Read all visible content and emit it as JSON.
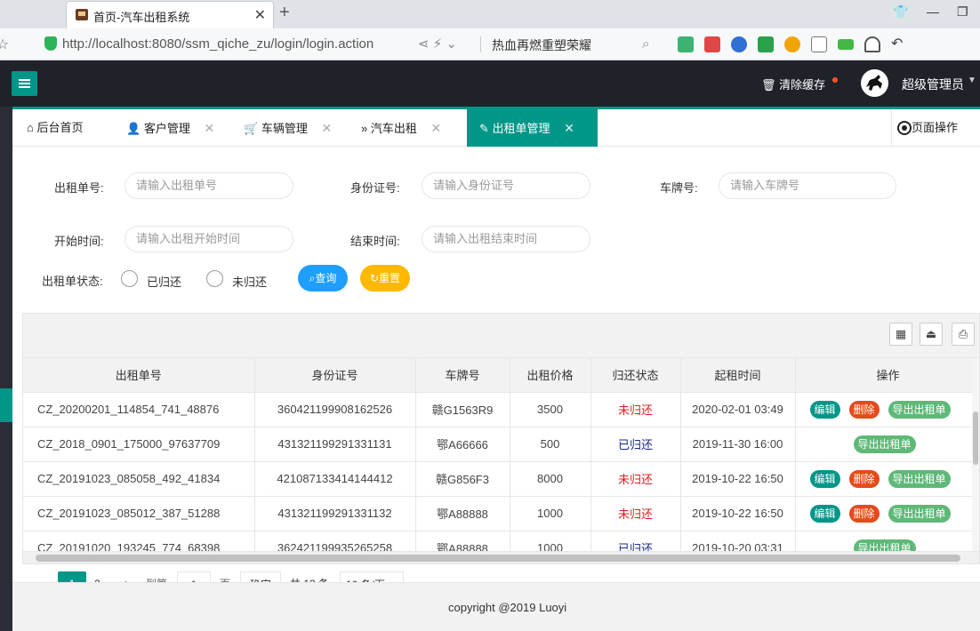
{
  "browser": {
    "tab_title": "首页-汽车出租系统",
    "url": "http://localhost:8080/ssm_qiche_zu/login/login.action",
    "search_hint": "热血再燃重塑荣耀"
  },
  "header": {
    "clear_cache": "清除缓存",
    "admin_name": "超级管理员"
  },
  "tabs": [
    {
      "label": "后台首页"
    },
    {
      "label": "客户管理"
    },
    {
      "label": "车辆管理"
    },
    {
      "label": "汽车出租"
    },
    {
      "label": "出租单管理"
    }
  ],
  "page_op": "页面操作",
  "filters": {
    "order_no_label": "出租单号:",
    "order_no_placeholder": "请输入出租单号",
    "id_label": "身份证号:",
    "id_placeholder": "请输入身份证号",
    "plate_label": "车牌号:",
    "plate_placeholder": "请输入车牌号",
    "start_label": "开始时间:",
    "start_placeholder": "请输入出租开始时间",
    "end_label": "结束时间:",
    "end_placeholder": "请输入出租结束时间",
    "status_label": "出租单状态:",
    "status_returned": "已归还",
    "status_not_returned": "未归还",
    "query_btn": "查询",
    "reset_btn": "重置"
  },
  "table": {
    "columns": [
      "出租单号",
      "身份证号",
      "车牌号",
      "出租价格",
      "归还状态",
      "起租时间",
      "操作"
    ],
    "rows": [
      {
        "order": "CZ_20200201_114854_741_48876",
        "id": "360421199908162526",
        "plate": "赣G1563R9",
        "price": "3500",
        "status": "未归还",
        "start": "2020-02-01 03:49",
        "ops": [
          "编辑",
          "删除",
          "导出出租单"
        ]
      },
      {
        "order": "CZ_2018_0901_175000_97637709",
        "id": "431321199291331131",
        "plate": "鄂A66666",
        "price": "500",
        "status": "已归还",
        "start": "2019-11-30 16:00",
        "ops": [
          "导出出租单"
        ]
      },
      {
        "order": "CZ_20191023_085058_492_41834",
        "id": "421087133414144412",
        "plate": "赣G856F3",
        "price": "8000",
        "status": "未归还",
        "start": "2019-10-22 16:50",
        "ops": [
          "编辑",
          "删除",
          "导出出租单"
        ]
      },
      {
        "order": "CZ_20191023_085012_387_51288",
        "id": "431321199291331132",
        "plate": "鄂A88888",
        "price": "1000",
        "status": "未归还",
        "start": "2019-10-22 16:50",
        "ops": [
          "编辑",
          "删除",
          "导出出租单"
        ]
      },
      {
        "order": "CZ_20191020_193245_774_68398",
        "id": "362421199935265258",
        "plate": "鄂A88888",
        "price": "1000",
        "status": "已归还",
        "start": "2019-10-20 03:31",
        "ops": [
          "导出出租单"
        ]
      }
    ]
  },
  "pagination": {
    "current": "1",
    "next_page": "2",
    "goto_label": "到第",
    "goto_value": "1",
    "page_unit": "页",
    "confirm": "确定",
    "total": "共 13 条",
    "per_page": "10 条/页"
  },
  "footer": "copyright @2019 Luoyi"
}
